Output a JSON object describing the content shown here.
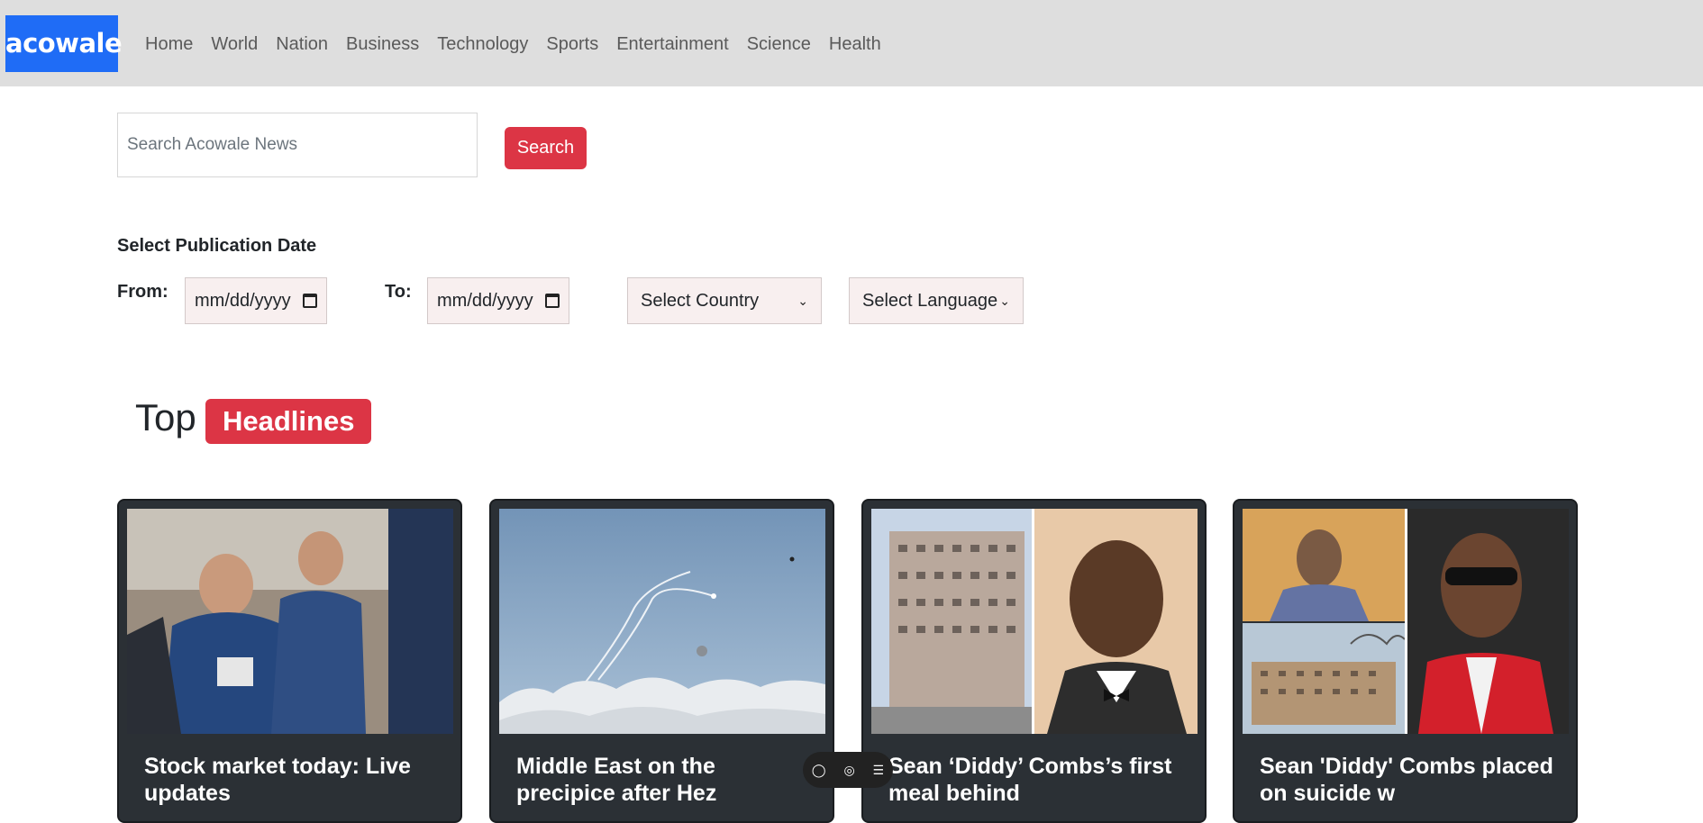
{
  "navbar": {
    "brand": "acowale",
    "links": [
      "Home",
      "World",
      "Nation",
      "Business",
      "Technology",
      "Sports",
      "Entertainment",
      "Science",
      "Health"
    ]
  },
  "search": {
    "placeholder": "Search Acowale News",
    "button_label": "Search"
  },
  "filters": {
    "heading": "Select Publication Date",
    "from_label": "From:",
    "to_label": "To:",
    "from_value": "mm/dd/yyyy",
    "to_value": "mm/dd/yyyy",
    "country_selected": "Select Country",
    "language_selected": "Select Language"
  },
  "headlines": {
    "title_plain": "Top",
    "title_badge": "Headlines",
    "cards": [
      {
        "title": "Stock market today: Live updates",
        "image": "traders-on-floor"
      },
      {
        "title": "Middle East on the precipice after Hez",
        "image": "missile-trails-sky"
      },
      {
        "title": "Sean ‘Diddy’ Combs’s first meal behind",
        "image": "prison-and-portrait"
      },
      {
        "title": "Sean 'Diddy' Combs placed on suicide w",
        "image": "sketch-prison-portrait"
      }
    ]
  },
  "floating_toolbar": {
    "icons": [
      "chat-icon",
      "eye-icon",
      "list-icon"
    ]
  }
}
